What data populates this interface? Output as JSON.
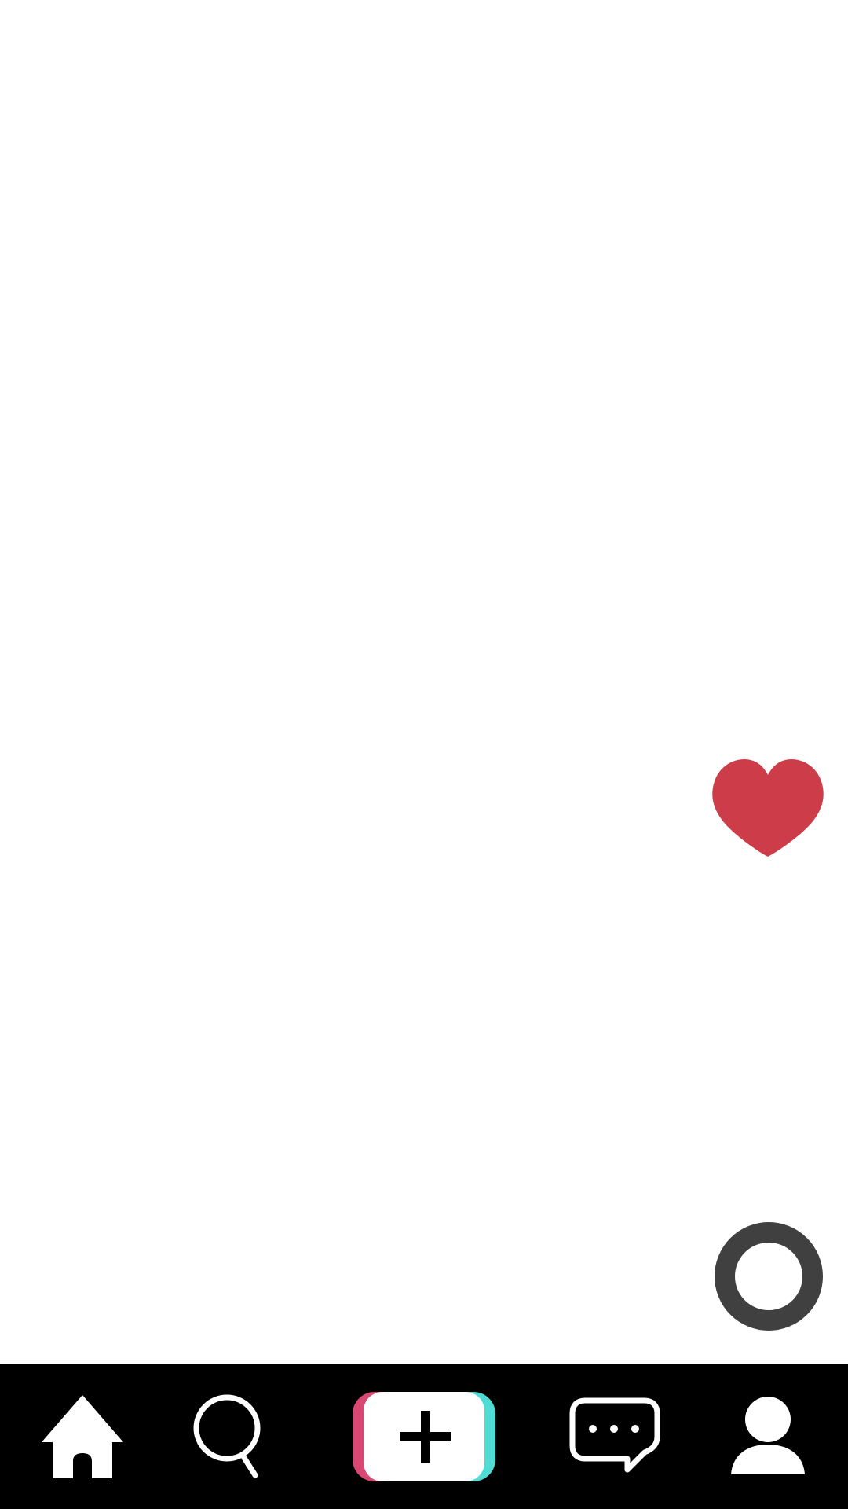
{
  "feed": {
    "like_icon": "heart-icon",
    "like_color": "#cc3d49",
    "music_icon": "disc-icon",
    "music_color": "#404040"
  },
  "bottom_nav": {
    "background": "#000000",
    "items": [
      {
        "id": "home",
        "icon": "home-icon",
        "label": ""
      },
      {
        "id": "discover",
        "icon": "search-icon",
        "label": ""
      },
      {
        "id": "create",
        "icon": "plus-icon",
        "label": ""
      },
      {
        "id": "inbox",
        "icon": "chat-bubble-icon",
        "label": ""
      },
      {
        "id": "profile",
        "icon": "person-icon",
        "label": ""
      }
    ],
    "create_colors": {
      "left_accent": "#d94773",
      "right_accent": "#4fdcd4",
      "face": "#ffffff",
      "plus": "#000000"
    }
  }
}
